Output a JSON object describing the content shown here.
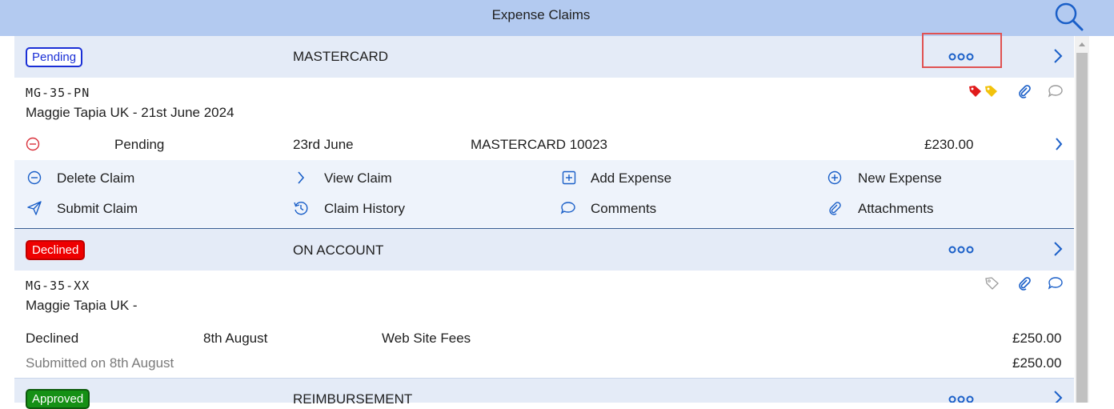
{
  "header": {
    "title": "Expense Claims",
    "search_icon": "search-icon"
  },
  "claims": [
    {
      "status": "Pending",
      "type": "MASTERCARD",
      "ref": "MG-35-PN",
      "title": "Maggie Tapia UK - 21st June 2024",
      "line": {
        "status": "Pending",
        "date": "23rd June",
        "desc": "MASTERCARD 10023",
        "amount": "£230.00"
      },
      "actions": {
        "delete": "Delete Claim",
        "view": "View Claim",
        "add_expense": "Add Expense",
        "new_expense": "New Expense",
        "submit": "Submit Claim",
        "history": "Claim History",
        "comments": "Comments",
        "attachments": "Attachments"
      }
    },
    {
      "status": "Declined",
      "type": "ON ACCOUNT",
      "ref": "MG-35-XX",
      "title": "Maggie Tapia UK -",
      "line": {
        "status": "Declined",
        "date": "8th August",
        "desc": "Web Site Fees",
        "amount": "£250.00"
      },
      "submitted": "Submitted on 8th August",
      "total": "£250.00"
    },
    {
      "status": "Approved",
      "type": "REIMBURSEMENT"
    }
  ],
  "colors": {
    "header_bg": "#b3caf0",
    "band_bg": "#e4ebf7",
    "accent": "#1a5fc8",
    "pending": "#1a2fd6",
    "declined": "#ee0000",
    "approved": "#159015"
  }
}
